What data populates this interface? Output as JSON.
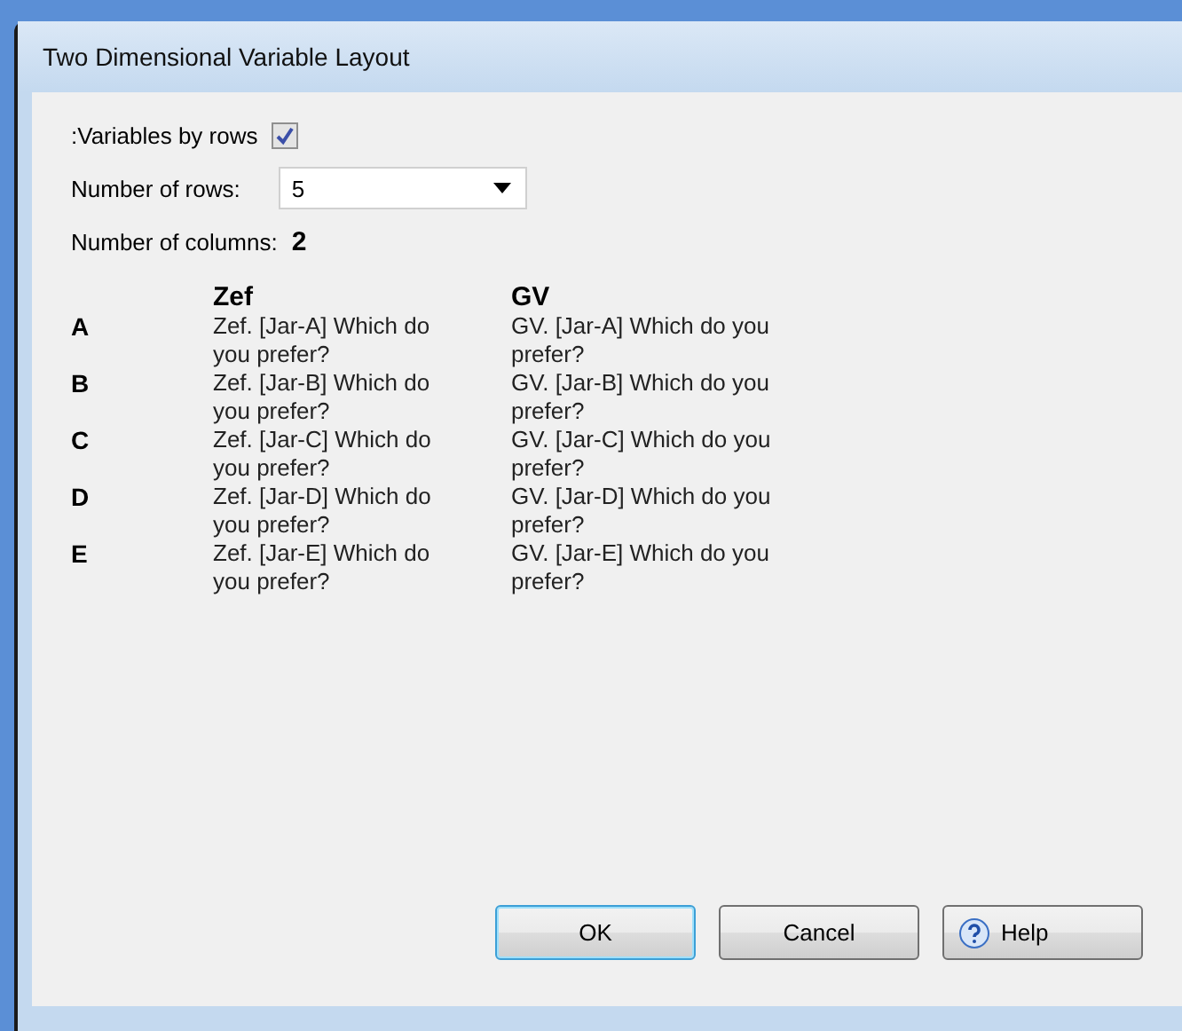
{
  "window": {
    "title": "Two Dimensional Variable Layout"
  },
  "variables_by_rows": {
    "label": ":Variables by rows",
    "checked": true
  },
  "number_of_rows": {
    "label": "Number of rows:",
    "value": "5"
  },
  "number_of_columns": {
    "label": "Number of columns:",
    "value": "2"
  },
  "grid": {
    "columns": [
      "Zef",
      "GV"
    ],
    "rows": [
      {
        "label": "A",
        "cells": [
          "Zef. [Jar-A] Which do you prefer?",
          "GV. [Jar-A] Which do you prefer?"
        ]
      },
      {
        "label": "B",
        "cells": [
          "Zef. [Jar-B] Which do you prefer?",
          "GV. [Jar-B] Which do you prefer?"
        ]
      },
      {
        "label": "C",
        "cells": [
          "Zef. [Jar-C] Which do you prefer?",
          "GV. [Jar-C] Which do you prefer?"
        ]
      },
      {
        "label": "D",
        "cells": [
          "Zef. [Jar-D] Which do you prefer?",
          "GV. [Jar-D] Which do you prefer?"
        ]
      },
      {
        "label": "E",
        "cells": [
          "Zef. [Jar-E] Which do you prefer?",
          "GV. [Jar-E] Which do you prefer?"
        ]
      }
    ]
  },
  "buttons": [
    {
      "label": "OK",
      "kind": "default"
    },
    {
      "label": "Cancel",
      "kind": "plain"
    },
    {
      "label": "Help",
      "kind": "help"
    }
  ]
}
